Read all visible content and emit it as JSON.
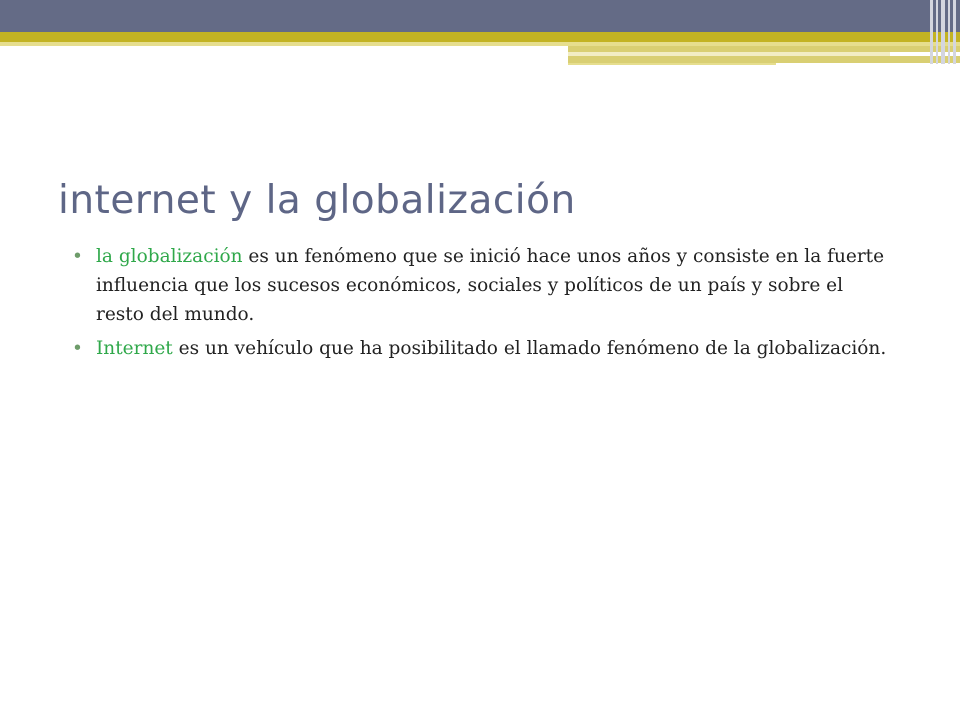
{
  "slide": {
    "title": "internet y la globalización",
    "bullets": [
      {
        "highlight": "la globalización",
        "text": " es un fenómeno que se inició hace unos años y consiste en la fuerte influencia que los sucesos económicos, sociales y políticos de un país y sobre el resto del mundo."
      },
      {
        "highlight": "Internet",
        "text": " es un vehículo que ha posibilitado el llamado fenómeno de la globalización."
      }
    ],
    "bullet_glyph": "•"
  },
  "colors": {
    "header_band": "#646B86",
    "gold_band": "#C3B323",
    "title": "#5E6686",
    "highlight": "#2FA84A"
  }
}
